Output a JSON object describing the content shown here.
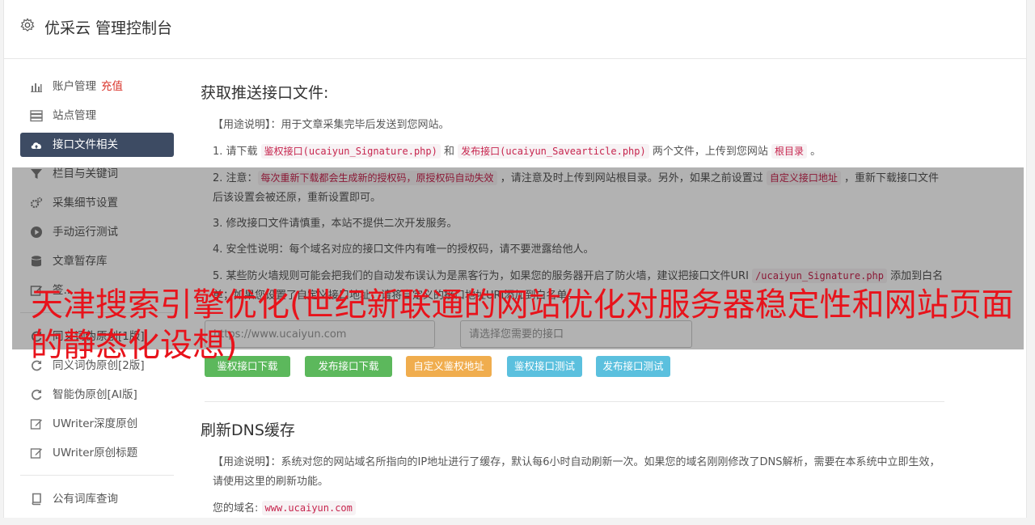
{
  "header": {
    "title": "优采云 管理控制台",
    "icon": "gear-icon"
  },
  "sidebar": {
    "items": [
      {
        "label": "账户管理",
        "extra": "充值",
        "icon": "bar-chart-icon"
      },
      {
        "label": "站点管理",
        "icon": "server-icon"
      },
      {
        "label": "接口文件相关",
        "icon": "cloud-upload-icon",
        "active": true
      },
      {
        "label": "栏目与关键词",
        "icon": "filter-icon"
      },
      {
        "label": "采集细节设置",
        "icon": "cogs-icon"
      },
      {
        "label": "手动运行测试",
        "icon": "play-circle-icon"
      },
      {
        "label": "文章暂存库",
        "icon": "database-icon"
      },
      {
        "label": "签...",
        "icon": "edit-icon"
      },
      {
        "label": "同义词伪原创[1版]",
        "icon": "refresh-icon"
      },
      {
        "label": "同义词伪原创[2版]",
        "icon": "refresh-icon"
      },
      {
        "label": "智能伪原创[AI版]",
        "icon": "refresh-icon"
      },
      {
        "label": "UWriter深度原创",
        "icon": "edit-icon"
      },
      {
        "label": "UWriter原创标题",
        "icon": "edit-icon"
      },
      {
        "label": "公有词库查询",
        "icon": "book-icon"
      }
    ]
  },
  "section1": {
    "title": "获取推送接口文件:",
    "usage_label": "【用途说明】",
    "usage_text": "：用于文章采集完毕后发送到您网站。",
    "step1": {
      "a": "1. 请下载 ",
      "code1": "鉴权接口(ucaiyun_Signature.php)",
      "b": " 和 ",
      "code2": "发布接口(ucaiyun_Savearticle.php)",
      "c": " 两个文件，上传到您网站 ",
      "code3": "根目录",
      "d": " 。"
    },
    "step2": {
      "a": "2. 注意：",
      "code1": "每次重新下载都会生成新的授权码，原授权码自动失效",
      "b": " ，请注意及时上传到网站根目录。另外，如果之前设置过 ",
      "code2": "自定义接口地址",
      "c": " ，重新下载接口文件后该设置会被还原，重新设置即可。"
    },
    "step3": "3. 修改接口文件请慎重，本站不提供二次开发服务。",
    "step4": "4. 安全性说明：每个域名对应的接口文件内有唯一的授权码，请不要泄露给他人。",
    "step5": {
      "a": "5. 某些防火墙规则可能会把我们的自动发布误认为是黑客行为，如果您的服务器开启了防火墙，建议把接口文件URI ",
      "code1": "/ucaiyun_Signature.php",
      "b": " 添加到白名单；如果您设置了自定义接口地址，请将自定义的接口地址URI添加到白名单。"
    },
    "url_input_value": "https://www.ucaiyun.com",
    "select_placeholder": "请选择您需要的接口",
    "buttons": [
      {
        "label": "鉴权接口下载",
        "color": "#5cb85c"
      },
      {
        "label": "发布接口下载",
        "color": "#5cb85c"
      },
      {
        "label": "自定义鉴权地址",
        "color": "#f0ad4e"
      },
      {
        "label": "鉴权接口测试",
        "color": "#5bc0de"
      },
      {
        "label": "发布接口测试",
        "color": "#5bc0de"
      }
    ]
  },
  "section2": {
    "title": "刷新DNS缓存",
    "usage_label": "【用途说明】",
    "usage_text": "：系统对您的网站域名所指向的IP地址进行了缓存，默认每6小时自动刷新一次。如果您的域名刚刚修改了DNS解析，需要在本系统中立即生效，请使用这里的刷新功能。",
    "domain_label": "您的域名: ",
    "domain_value": "www.ucaiyun.com"
  },
  "overlay_text": "天津搜索引擎优化(世纪新联通的网站优化对服务器稳定性和网站页面的静态化设想)"
}
